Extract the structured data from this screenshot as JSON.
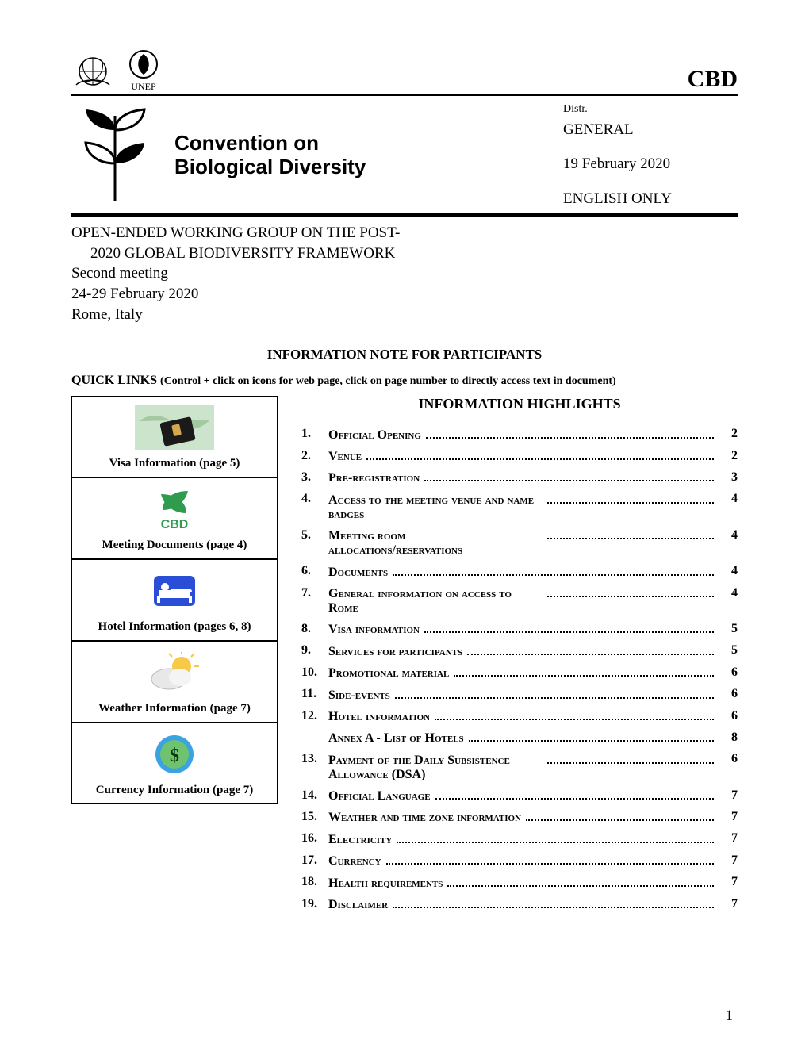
{
  "header": {
    "org_abbrev": "CBD",
    "unep_caption": "UNEP",
    "title_line1": "Convention on",
    "title_line2": "Biological Diversity",
    "distr_label": "Distr.",
    "distr_value": "GENERAL",
    "date": "19 February 2020",
    "language": "ENGLISH ONLY"
  },
  "meeting": {
    "wg_line1": "OPEN-ENDED WORKING GROUP ON THE POST-",
    "wg_line2": "2020 GLOBAL BIODIVERSITY FRAMEWORK",
    "session": "Second meeting",
    "dates": "24-29 February 2020",
    "location": "Rome, Italy"
  },
  "note_title": "INFORMATION NOTE FOR PARTICIPANTS",
  "quick_links": {
    "lead": "QUICK LINKS",
    "sub": "(Control + click on icons for web page, click on page number to directly access text in document)"
  },
  "highlights_title": "INFORMATION HIGHLIGHTS",
  "quick_cards": [
    {
      "label": "Visa Information (page 5)",
      "icon": "passport-map-icon"
    },
    {
      "label": "Meeting Documents (page 4)",
      "icon": "cbd-leaf-icon",
      "caption": "CBD"
    },
    {
      "label": "Hotel Information (pages 6, 8)",
      "icon": "hotel-bed-icon"
    },
    {
      "label": "Weather Information (page 7)",
      "icon": "weather-icon"
    },
    {
      "label": "Currency Information (page 7)",
      "icon": "currency-icon"
    }
  ],
  "toc": [
    {
      "n": "1.",
      "label": "Official Opening",
      "page": "2"
    },
    {
      "n": "2.",
      "label": "Venue",
      "page": "2"
    },
    {
      "n": "3.",
      "label": "Pre-registration",
      "page": "3"
    },
    {
      "n": "4.",
      "label": "Access to the meeting venue and name badges",
      "page": "4"
    },
    {
      "n": "5.",
      "label": "Meeting room allocations/reservations",
      "page": "4"
    },
    {
      "n": "6.",
      "label": "Documents",
      "page": "4"
    },
    {
      "n": "7.",
      "label": "General information on access to Rome",
      "page": "4"
    },
    {
      "n": "8.",
      "label": "Visa information",
      "page": "5"
    },
    {
      "n": "9.",
      "label": "Services for participants",
      "page": "5"
    },
    {
      "n": "10.",
      "label": "Promotional material",
      "page": "6"
    },
    {
      "n": "11.",
      "label": "Side-events",
      "page": "6"
    },
    {
      "n": "12.",
      "label": "Hotel information",
      "page": "6",
      "sub_label": "Annex A - List of Hotels",
      "sub_page": "8"
    },
    {
      "n": "13.",
      "label": "Payment of the Daily Subsistence Allowance (DSA)",
      "page": "6"
    },
    {
      "n": "14.",
      "label": "Official Language",
      "page": "7"
    },
    {
      "n": "15.",
      "label": "Weather and time zone information",
      "page": "7"
    },
    {
      "n": "16.",
      "label": "Electricity",
      "page": "7"
    },
    {
      "n": "17.",
      "label": "Currency",
      "page": "7"
    },
    {
      "n": "18.",
      "label": "Health requirements",
      "page": "7"
    },
    {
      "n": "19.",
      "label": "Disclaimer",
      "page": "7"
    }
  ],
  "page_number": "1"
}
